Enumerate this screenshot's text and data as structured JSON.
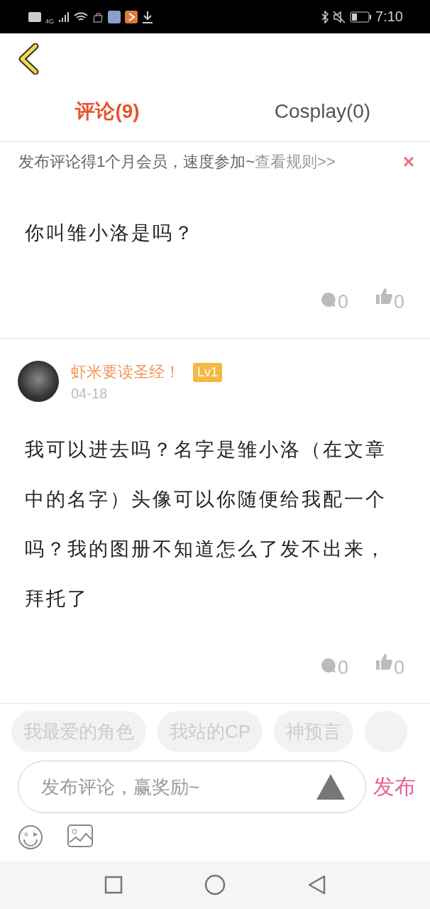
{
  "status_bar": {
    "time": "7:10",
    "network": "4G"
  },
  "tabs": [
    {
      "label": "评论(9)",
      "selected": true
    },
    {
      "label": "Cosplay(0)",
      "selected": false
    }
  ],
  "banner": {
    "text": "发布评论得1个月会员，速度参加~",
    "link": "查看规则>>",
    "close": "×"
  },
  "comments": [
    {
      "body": "你叫雏小洛是吗？",
      "replies": "0",
      "likes": "0"
    },
    {
      "name": "虾米要读圣经！",
      "level": "Lv1",
      "date": "04-18",
      "body": "我可以进去吗？名字是雏小洛（在文章中的名字）头像可以你随便给我配一个吗？我的图册不知道怎么了发不出来，拜托了",
      "replies": "0",
      "likes": "0"
    }
  ],
  "tags": [
    "我最爱的角色",
    "我站的CP",
    "神预言"
  ],
  "composer": {
    "placeholder": "发布评论，赢奖励~",
    "send": "发布"
  }
}
